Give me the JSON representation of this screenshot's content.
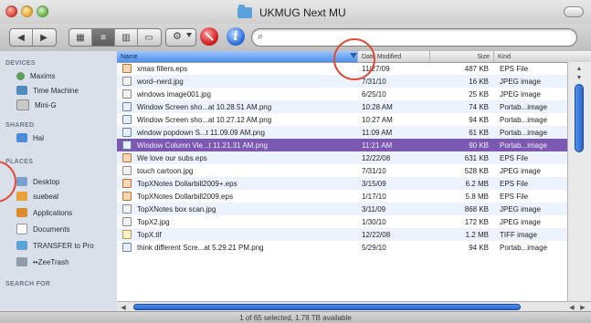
{
  "window": {
    "title": "UKMUG Next MU"
  },
  "search": {
    "placeholder": ""
  },
  "sidebar": {
    "sections": [
      "DEVICES",
      "SHARED",
      "PLACES",
      "SEARCH FOR"
    ],
    "devices": [
      "Maxims",
      "Time Machine",
      "Mini-G"
    ],
    "shared": [
      "Hal"
    ],
    "places": [
      "Desktop",
      "suebeal",
      "Applications",
      "Documents",
      "TRANSFER to Pro",
      "••ZeeTrash"
    ]
  },
  "columns": {
    "name": "Name",
    "date": "Date Modified",
    "size": "Size",
    "kind": "Kind"
  },
  "files": [
    {
      "name": "xmas fillers.eps",
      "date": "11/27/09",
      "size": "487 KB",
      "kind": "EPS File",
      "icon": "eps"
    },
    {
      "name": "word–nerd.jpg",
      "date": "7/31/10",
      "size": "16 KB",
      "kind": "JPEG image",
      "icon": "jpg"
    },
    {
      "name": "windows image001.jpg",
      "date": "6/25/10",
      "size": "25 KB",
      "kind": "JPEG image",
      "icon": "jpg"
    },
    {
      "name": "Window Screen sho...at 10.28.51 AM.png",
      "date": "10:28 AM",
      "size": "74 KB",
      "kind": "Portab...image",
      "icon": "png"
    },
    {
      "name": "Window Screen sho...at 10.27.12 AM.png",
      "date": "10:27 AM",
      "size": "94 KB",
      "kind": "Portab...image",
      "icon": "png"
    },
    {
      "name": "window popdown S...t 11.09.09 AM.png",
      "date": "11:09 AM",
      "size": "61 KB",
      "kind": "Portab...image",
      "icon": "png"
    },
    {
      "name": "Window Column Vie...t 11.21.31 AM.png",
      "date": "11:21 AM",
      "size": "90 KB",
      "kind": "Portab...image",
      "icon": "png",
      "selected": true
    },
    {
      "name": "We love our subs.eps",
      "date": "12/22/08",
      "size": "631 KB",
      "kind": "EPS File",
      "icon": "eps"
    },
    {
      "name": "touch cartoon.jpg",
      "date": "7/31/10",
      "size": "528 KB",
      "kind": "JPEG image",
      "icon": "jpg"
    },
    {
      "name": "TopXNotes Dollarbill2009+.eps",
      "date": "3/15/09",
      "size": "6.2 MB",
      "kind": "EPS File",
      "icon": "eps"
    },
    {
      "name": "TopXNotes Dollarbill2009.eps",
      "date": "1/17/10",
      "size": "5.8 MB",
      "kind": "EPS File",
      "icon": "eps"
    },
    {
      "name": "TopXNotes box scan.jpg",
      "date": "3/11/09",
      "size": "868 KB",
      "kind": "JPEG image",
      "icon": "jpg"
    },
    {
      "name": "TopX2.jpg",
      "date": "1/30/10",
      "size": "172 KB",
      "kind": "JPEG image",
      "icon": "jpg"
    },
    {
      "name": "TopX.tif",
      "date": "12/22/08",
      "size": "1.2 MB",
      "kind": "TIFF image",
      "icon": "tif"
    },
    {
      "name": "think different Scre...at 5.29.21 PM.png",
      "date": "5/29/10",
      "size": "94 KB",
      "kind": "Portab...image",
      "icon": "png"
    }
  ],
  "status": {
    "text": "1 of 65 selected, 1.78 TB available"
  }
}
